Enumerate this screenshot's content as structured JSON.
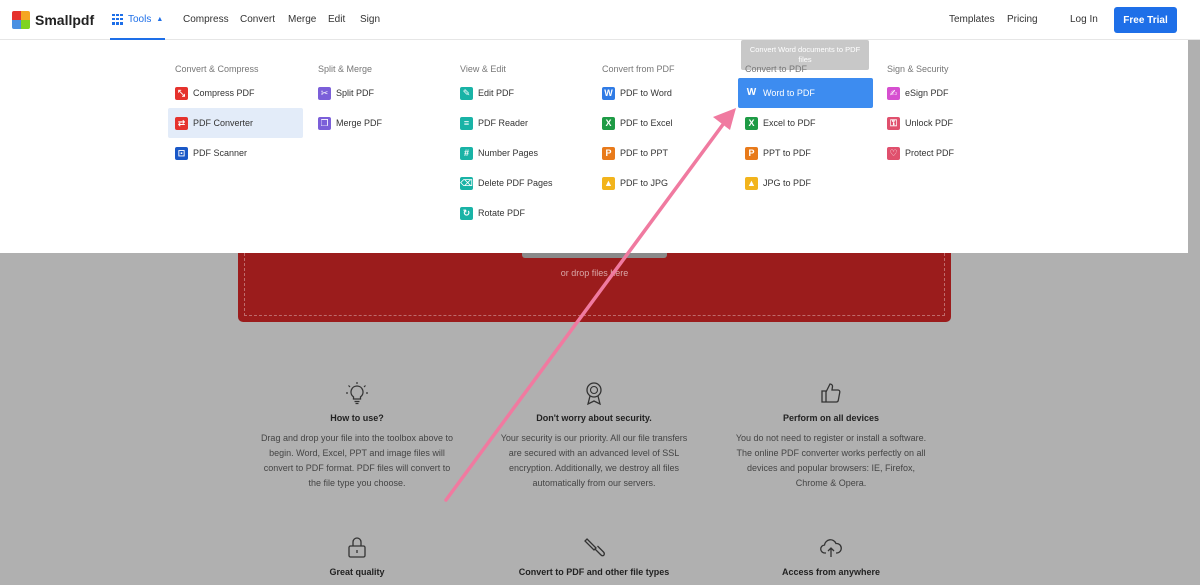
{
  "header": {
    "logo": "Smallpdf",
    "tools": "Tools",
    "nav": [
      "Compress",
      "Convert",
      "Merge",
      "Edit",
      "Sign"
    ],
    "templates": "Templates",
    "pricing": "Pricing",
    "login": "Log In",
    "cta": "Free Trial"
  },
  "dropdown": {
    "tooltip": "Convert Word documents to PDF files",
    "columns": [
      {
        "heading": "Convert & Compress",
        "items": [
          "Compress PDF",
          "PDF Converter",
          "PDF Scanner"
        ]
      },
      {
        "heading": "Split & Merge",
        "items": [
          "Split PDF",
          "Merge PDF"
        ]
      },
      {
        "heading": "View & Edit",
        "items": [
          "Edit PDF",
          "PDF Reader",
          "Number Pages",
          "Delete PDF Pages",
          "Rotate PDF"
        ]
      },
      {
        "heading": "Convert from PDF",
        "items": [
          "PDF to Word",
          "PDF to Excel",
          "PDF to PPT",
          "PDF to JPG"
        ]
      },
      {
        "heading": "Convert to PDF",
        "items": [
          "Word to PDF",
          "Excel to PDF",
          "PPT to PDF",
          "JPG to PDF"
        ]
      },
      {
        "heading": "Sign & Security",
        "items": [
          "eSign PDF",
          "Unlock PDF",
          "Protect PDF"
        ]
      }
    ]
  },
  "dropzone": {
    "text": "or drop files here"
  },
  "features": [
    {
      "title": "How to use?",
      "body": "Drag and drop your file into the toolbox above to begin. Word, Excel, PPT and image files will convert to PDF format. PDF files will convert to the file type you choose."
    },
    {
      "title": "Don't worry about security.",
      "body": "Your security is our priority. All our file transfers are secured with an advanced level of SSL encryption. Additionally, we destroy all files automatically from our servers."
    },
    {
      "title": "Perform on all devices",
      "body": "You do not need to register or install a software. The online PDF converter works perfectly on all devices and popular browsers: IE, Firefox, Chrome & Opera."
    },
    {
      "title": "Great quality"
    },
    {
      "title": "Convert to PDF and other file types"
    },
    {
      "title": "Access from anywhere"
    }
  ],
  "colors": {
    "accent": "#1e6fe8",
    "highlight": "#3d8cf0",
    "dropzone": "#9b1c1c",
    "annotation_arrow": "#f07aa0"
  }
}
